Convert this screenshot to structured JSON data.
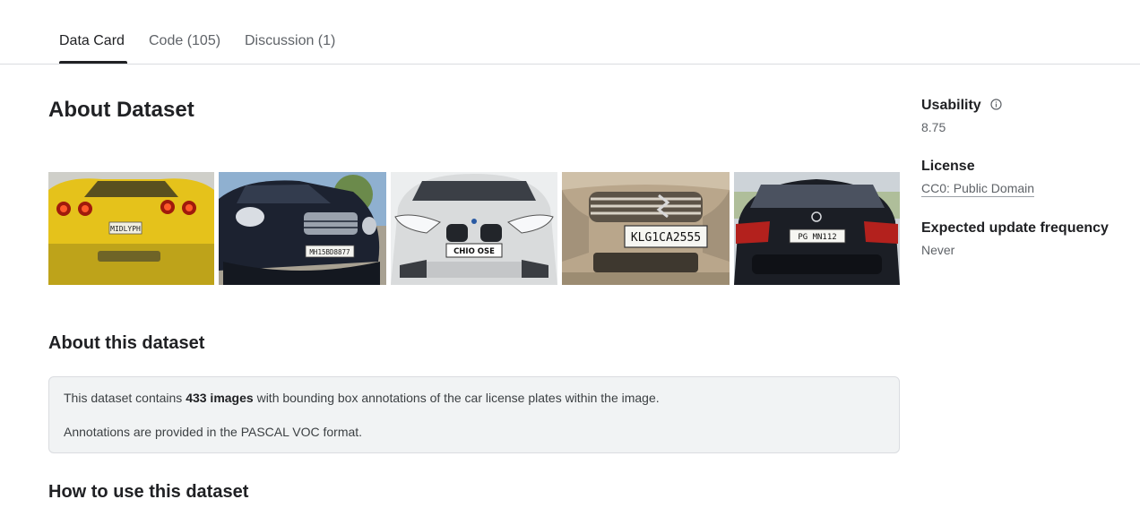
{
  "tabs": [
    {
      "label": "Data Card",
      "active": true
    },
    {
      "label": "Code (105)",
      "active": false
    },
    {
      "label": "Discussion (1)",
      "active": false
    }
  ],
  "main": {
    "title": "About Dataset",
    "gallery": [
      {
        "plate": "MIDLYPH",
        "color": "#e5c21b"
      },
      {
        "plate": "MH15BD8877",
        "color": "#1c2230"
      },
      {
        "plate": "CHIO OSE",
        "color": "#d9dbdc"
      },
      {
        "plate": "KLG1CA2555",
        "color": "#b9a68b"
      },
      {
        "plate": "PG MN112",
        "color": "#1b1e25"
      }
    ],
    "about_heading": "About this dataset",
    "desc_prefix": "This dataset contains ",
    "desc_bold": "433 images",
    "desc_suffix": " with bounding box annotations of the car license plates within the image.",
    "desc_line2": "Annotations are provided in the PASCAL VOC format.",
    "howto_heading": "How to use this dataset"
  },
  "sidebar": {
    "usability_label": "Usability",
    "usability_icon": "info-icon",
    "usability_value": "8.75",
    "license_label": "License",
    "license_value": "CC0: Public Domain",
    "frequency_label": "Expected update frequency",
    "frequency_value": "Never"
  },
  "colors": {
    "text_primary": "#202124",
    "text_secondary": "#5f6368",
    "description_background": "#f1f3f4",
    "border": "#dadce0"
  }
}
